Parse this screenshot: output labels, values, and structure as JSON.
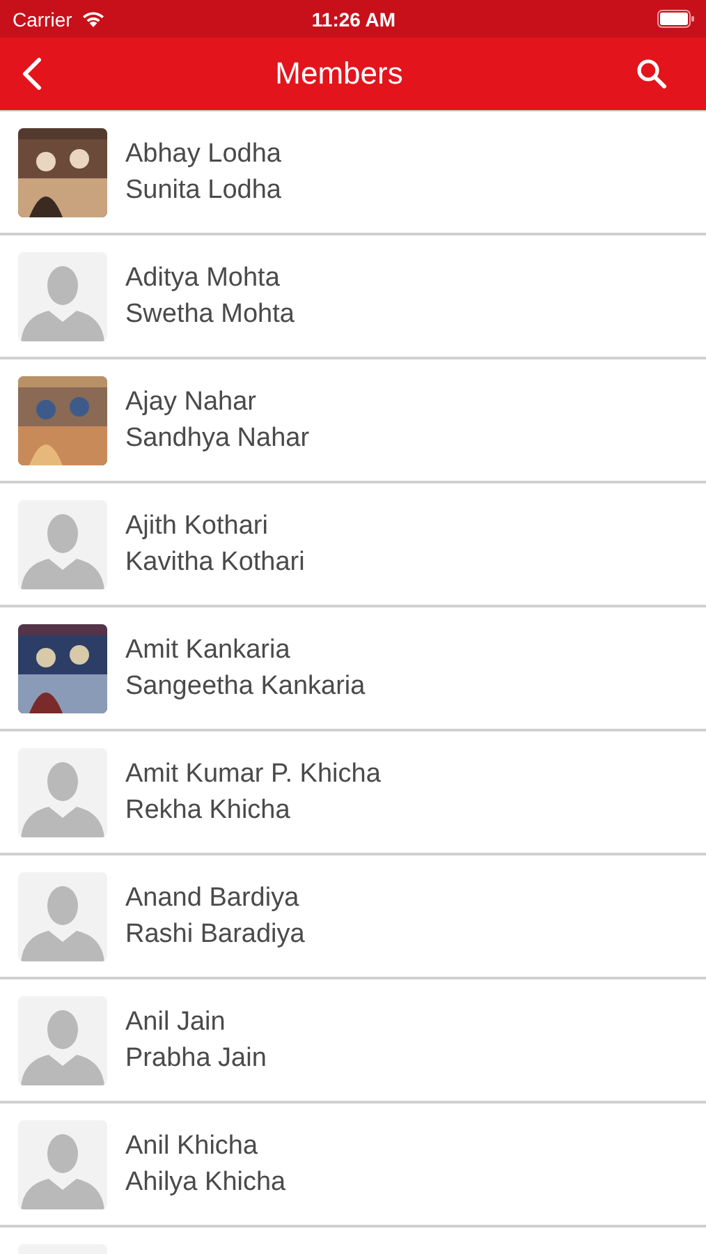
{
  "status_bar": {
    "carrier": "Carrier",
    "time": "11:26 AM"
  },
  "nav_bar": {
    "title": "Members"
  },
  "members": [
    {
      "kind": "picture",
      "names": [
        "Abhay Lodha",
        "Sunita Lodha"
      ]
    },
    {
      "kind": "placeholder",
      "names": [
        "Aditya Mohta",
        "Swetha Mohta"
      ]
    },
    {
      "kind": "picture",
      "names": [
        "Ajay Nahar",
        "Sandhya Nahar"
      ]
    },
    {
      "kind": "placeholder",
      "names": [
        "Ajith Kothari",
        "Kavitha Kothari"
      ]
    },
    {
      "kind": "picture",
      "names": [
        "Amit Kankaria",
        "Sangeetha Kankaria"
      ]
    },
    {
      "kind": "placeholder",
      "names": [
        "Amit Kumar P. Khicha",
        "Rekha Khicha"
      ]
    },
    {
      "kind": "placeholder",
      "names": [
        "Anand Bardiya",
        "Rashi Baradiya"
      ]
    },
    {
      "kind": "placeholder",
      "names": [
        "Anil Jain",
        "Prabha Jain"
      ]
    },
    {
      "kind": "placeholder",
      "names": [
        "Anil Khicha",
        "Ahilya Khicha"
      ]
    },
    {
      "kind": "placeholder"
    }
  ]
}
